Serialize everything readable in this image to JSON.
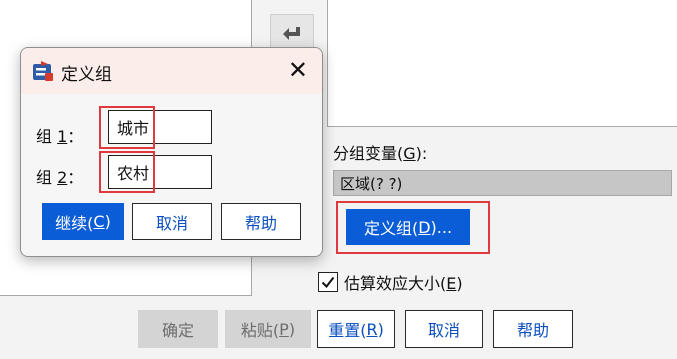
{
  "group_variable": {
    "label": "分组变量(",
    "mnemonic": "G",
    "suffix": "):",
    "value": "区域(? ?)"
  },
  "define_groups_button": {
    "label": "定义组(",
    "mnemonic": "D",
    "suffix": ")..."
  },
  "estimate_effect_size": {
    "label": "估算效应大小(",
    "mnemonic": "E",
    "suffix": ")",
    "checked": true
  },
  "footer_buttons": {
    "ok": "确定",
    "paste": {
      "label": "粘贴(",
      "mnemonic": "P",
      "suffix": ")"
    },
    "reset": {
      "label": "重置(",
      "mnemonic": "R",
      "suffix": ")"
    },
    "cancel": "取消",
    "help": "帮助"
  },
  "define_dialog": {
    "title": "定义组",
    "close_glyph": "✕",
    "group1": {
      "label_prefix": "组 ",
      "mnemonic": "1",
      "label_suffix": "：",
      "value": "城市"
    },
    "group2": {
      "label_prefix": "组 ",
      "mnemonic": "2",
      "label_suffix": "：",
      "value": "农村"
    },
    "buttons": {
      "continue": {
        "label": "继续(",
        "mnemonic": "C",
        "suffix": ")"
      },
      "cancel": "取消",
      "help": "帮助"
    }
  },
  "colors": {
    "accent": "#0b5cd7",
    "highlight": "#e0393e",
    "title_bar": "#fbeeea"
  },
  "icons": {
    "move_arrow": "arrow-left-icon",
    "dialog": "app-icon",
    "close": "close-icon",
    "check": "checkmark-icon"
  }
}
